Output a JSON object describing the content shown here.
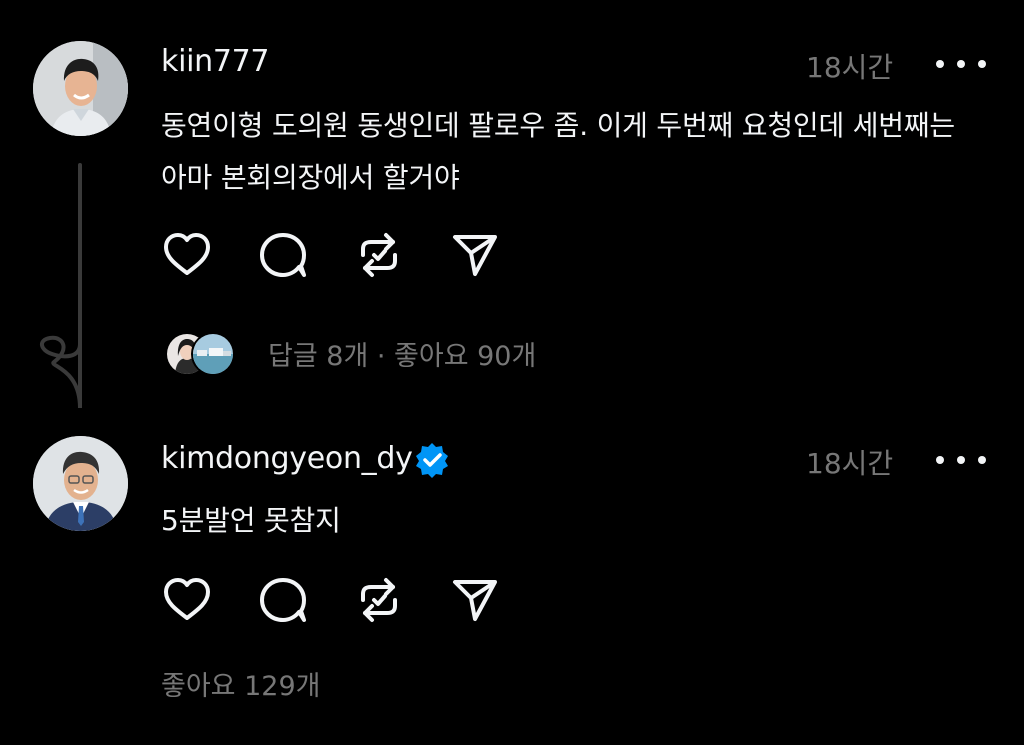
{
  "theme": {
    "background": "#000000",
    "text": "#f3f5f7",
    "muted": "#777777",
    "verified_badge": "#0095f6"
  },
  "posts": [
    {
      "username": "kiin777",
      "time": "18시간",
      "text": "동연이형 도의원 동생인데 팔로우 좀. 이게 두번째 요청인데 세번째는 아마 본회의장에서 할거야",
      "verified": false,
      "stats": "답글 8개 · 좋아요 90개",
      "avatar_icon": "person-avatar",
      "replier_avatars": [
        "replier-avatar-1",
        "replier-avatar-2"
      ]
    },
    {
      "username": "kimdongyeon_dy",
      "time": "18시간",
      "text": "5분발언 못참지",
      "verified": true,
      "stats": "좋아요 129개",
      "avatar_icon": "person-avatar"
    }
  ],
  "icons": {
    "like": "heart-icon",
    "comment": "comment-icon",
    "repost": "repost-icon",
    "share": "send-icon",
    "more": "more-dots-icon",
    "verified": "verified-badge-icon"
  }
}
